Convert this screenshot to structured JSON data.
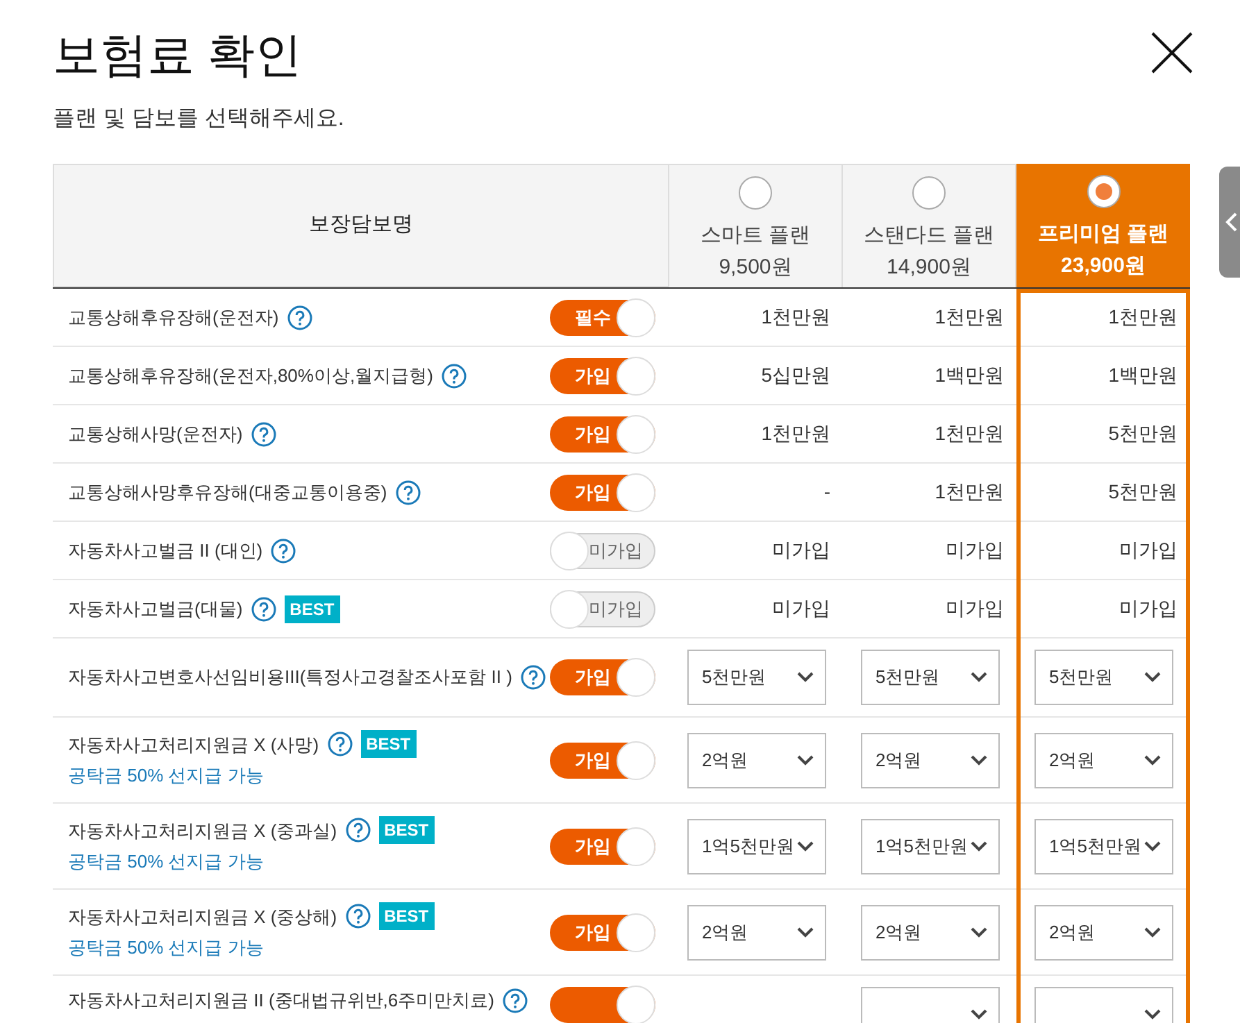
{
  "title": "보험료 확인",
  "subtitle": "플랜 및 담보를 선택해주세요.",
  "table": {
    "name_header": "보장담보명",
    "plans": [
      {
        "name": "스마트 플랜",
        "price": "9,500원",
        "selected": false
      },
      {
        "name": "스탠다드 플랜",
        "price": "14,900원",
        "selected": false
      },
      {
        "name": "프리미엄 플랜",
        "price": "23,900원",
        "selected": true
      }
    ],
    "rows": [
      {
        "name": "교통상해후유장해(운전자)",
        "best": false,
        "toggle": {
          "label": "필수",
          "on": true
        },
        "values": [
          {
            "kind": "text",
            "value": "1천만원"
          },
          {
            "kind": "text",
            "value": "1천만원"
          },
          {
            "kind": "text",
            "value": "1천만원"
          }
        ]
      },
      {
        "name": "교통상해후유장해(운전자,80%이상,월지급형)",
        "best": false,
        "toggle": {
          "label": "가입",
          "on": true
        },
        "values": [
          {
            "kind": "text",
            "value": "5십만원"
          },
          {
            "kind": "text",
            "value": "1백만원"
          },
          {
            "kind": "text",
            "value": "1백만원"
          }
        ]
      },
      {
        "name": "교통상해사망(운전자)",
        "best": false,
        "toggle": {
          "label": "가입",
          "on": true
        },
        "values": [
          {
            "kind": "text",
            "value": "1천만원"
          },
          {
            "kind": "text",
            "value": "1천만원"
          },
          {
            "kind": "text",
            "value": "5천만원"
          }
        ]
      },
      {
        "name": "교통상해사망후유장해(대중교통이용중)",
        "best": false,
        "toggle": {
          "label": "가입",
          "on": true
        },
        "values": [
          {
            "kind": "text",
            "value": "-"
          },
          {
            "kind": "text",
            "value": "1천만원"
          },
          {
            "kind": "text",
            "value": "5천만원"
          }
        ]
      },
      {
        "name": "자동차사고벌금 II (대인)",
        "best": false,
        "toggle": {
          "label": "미가입",
          "on": false
        },
        "values": [
          {
            "kind": "text",
            "value": "미가입"
          },
          {
            "kind": "text",
            "value": "미가입"
          },
          {
            "kind": "text",
            "value": "미가입"
          }
        ]
      },
      {
        "name": "자동차사고벌금(대물)",
        "best": true,
        "best_label": "BEST",
        "toggle": {
          "label": "미가입",
          "on": false
        },
        "values": [
          {
            "kind": "text",
            "value": "미가입"
          },
          {
            "kind": "text",
            "value": "미가입"
          },
          {
            "kind": "text",
            "value": "미가입"
          }
        ]
      },
      {
        "name": "자동차사고변호사선임비용III(특정사고경찰조사포함 II )",
        "best": false,
        "toggle": {
          "label": "가입",
          "on": true
        },
        "values": [
          {
            "kind": "select",
            "value": "5천만원"
          },
          {
            "kind": "select",
            "value": "5천만원"
          },
          {
            "kind": "select",
            "value": "5천만원"
          }
        ]
      },
      {
        "name": "자동차사고처리지원금 X (사망)",
        "best": true,
        "best_label": "BEST",
        "note": "공탁금 50% 선지급 가능",
        "toggle": {
          "label": "가입",
          "on": true
        },
        "values": [
          {
            "kind": "select",
            "value": "2억원"
          },
          {
            "kind": "select",
            "value": "2억원"
          },
          {
            "kind": "select",
            "value": "2억원"
          }
        ]
      },
      {
        "name": "자동차사고처리지원금 X (중과실)",
        "best": true,
        "best_label": "BEST",
        "note": "공탁금 50% 선지급 가능",
        "toggle": {
          "label": "가입",
          "on": true
        },
        "values": [
          {
            "kind": "select",
            "value": "1억5천만원"
          },
          {
            "kind": "select",
            "value": "1억5천만원"
          },
          {
            "kind": "select",
            "value": "1억5천만원"
          }
        ]
      },
      {
        "name": "자동차사고처리지원금 X (중상해)",
        "best": true,
        "best_label": "BEST",
        "note": "공탁금 50% 선지급 가능",
        "toggle": {
          "label": "가입",
          "on": true
        },
        "values": [
          {
            "kind": "select",
            "value": "2억원"
          },
          {
            "kind": "select",
            "value": "2억원"
          },
          {
            "kind": "select",
            "value": "2억원"
          }
        ]
      },
      {
        "name": "자동차사고처리지원금 II (중대법규위반,6주미만치료)",
        "best": false,
        "toggle": {
          "on": true
        },
        "values": [
          {
            "kind": "none"
          },
          {
            "kind": "select"
          },
          {
            "kind": "select"
          }
        ]
      }
    ]
  }
}
